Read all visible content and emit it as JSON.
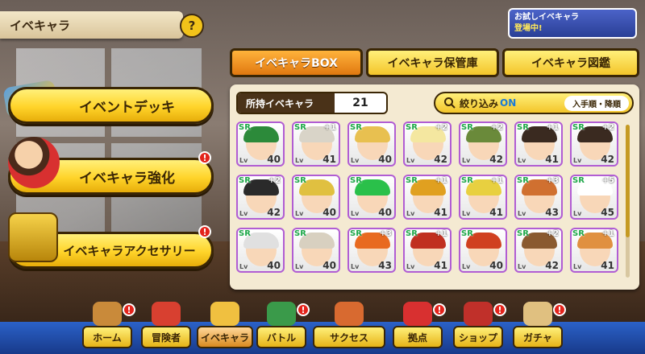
{
  "title": "イベキャラ",
  "help_symbol": "?",
  "promo": {
    "line1": "お試しイベキャラ",
    "line2": "登場中!"
  },
  "side_menu": [
    {
      "label": "イベントデッキ",
      "badge": ""
    },
    {
      "label": "イベキャラ強化",
      "badge": "!"
    },
    {
      "label": "イベキャラアクセサリー",
      "badge": "!"
    }
  ],
  "tabs": [
    {
      "label": "イベキャラBOX",
      "active": true
    },
    {
      "label": "イベキャラ保管庫",
      "active": false
    },
    {
      "label": "イベキャラ図鑑",
      "active": false
    }
  ],
  "owned": {
    "label": "所持イベキャラ",
    "value": "21"
  },
  "filter": {
    "label": "絞り込み",
    "state": "ON",
    "sort": "入手順・降順"
  },
  "cards": [
    {
      "rank": "SR",
      "lv": "Lv",
      "level": "40",
      "plus": "",
      "hair": "#2c8a3a"
    },
    {
      "rank": "SR",
      "lv": "Lv",
      "level": "41",
      "plus": "+1",
      "hair": "#d9d4c8"
    },
    {
      "rank": "SR",
      "lv": "Lv",
      "level": "40",
      "plus": "",
      "hair": "#e8c050"
    },
    {
      "rank": "SR",
      "lv": "Lv",
      "level": "42",
      "plus": "+2",
      "hair": "#f4e7a0"
    },
    {
      "rank": "SR",
      "lv": "Lv",
      "level": "42",
      "plus": "+2",
      "hair": "#6a8a3a"
    },
    {
      "rank": "SR",
      "lv": "Lv",
      "level": "41",
      "plus": "+1",
      "hair": "#3a2a20"
    },
    {
      "rank": "SR",
      "lv": "Lv",
      "level": "42",
      "plus": "+2",
      "hair": "#3a2a20"
    },
    {
      "rank": "SR",
      "lv": "Lv",
      "level": "42",
      "plus": "+2",
      "hair": "#2a2a2a"
    },
    {
      "rank": "SR",
      "lv": "Lv",
      "level": "40",
      "plus": "",
      "hair": "#e0c040"
    },
    {
      "rank": "SR",
      "lv": "Lv",
      "level": "40",
      "plus": "",
      "hair": "#2ac04a"
    },
    {
      "rank": "SR",
      "lv": "Lv",
      "level": "41",
      "plus": "+1",
      "hair": "#e0a020"
    },
    {
      "rank": "SR",
      "lv": "Lv",
      "level": "41",
      "plus": "+1",
      "hair": "#e8d040"
    },
    {
      "rank": "SR",
      "lv": "Lv",
      "level": "43",
      "plus": "+3",
      "hair": "#d07030"
    },
    {
      "rank": "SR",
      "lv": "Lv",
      "level": "45",
      "plus": "+5",
      "hair": "#ffffff"
    },
    {
      "rank": "SR",
      "lv": "Lv",
      "level": "40",
      "plus": "",
      "hair": "#e0e0e0"
    },
    {
      "rank": "SR",
      "lv": "Lv",
      "level": "40",
      "plus": "",
      "hair": "#d8d0c0"
    },
    {
      "rank": "SR",
      "lv": "Lv",
      "level": "43",
      "plus": "+3",
      "hair": "#e86a20"
    },
    {
      "rank": "SR",
      "lv": "Lv",
      "level": "41",
      "plus": "+1",
      "hair": "#c03020"
    },
    {
      "rank": "SR",
      "lv": "Lv",
      "level": "40",
      "plus": "",
      "hair": "#d04020"
    },
    {
      "rank": "SR",
      "lv": "Lv",
      "level": "42",
      "plus": "+2",
      "hair": "#8a5a30"
    },
    {
      "rank": "SR",
      "lv": "Lv",
      "level": "41",
      "plus": "+1",
      "hair": "#e09040"
    }
  ],
  "nav": [
    {
      "label": "ホーム",
      "badge": "!",
      "active": false
    },
    {
      "label": "冒険者",
      "badge": "",
      "active": false
    },
    {
      "label": "イベキャラ",
      "badge": "",
      "active": true
    },
    {
      "label": "バトル",
      "badge": "!",
      "active": false
    },
    {
      "label": "サクセス",
      "badge": "",
      "active": false
    },
    {
      "label": "拠点",
      "badge": "!",
      "active": false
    },
    {
      "label": "ショップ",
      "badge": "!",
      "active": false
    },
    {
      "label": "ガチャ",
      "badge": "!",
      "active": false
    }
  ],
  "colors": {
    "accent": "#ffd42a",
    "active_tab": "#e07810",
    "badge": "#e3231b",
    "nav_bg": "#2b62c8"
  }
}
